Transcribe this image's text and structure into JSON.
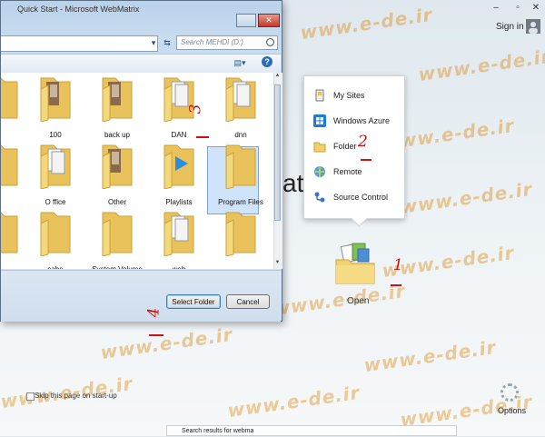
{
  "background_window": {
    "sign_in": "Sign in",
    "sign_in_arrow": "▾",
    "window_controls": {
      "minimize": "–",
      "restore": "▫",
      "close": "✕"
    },
    "title_fragment": "atrix",
    "open_menu": {
      "items": [
        {
          "label": "My Sites",
          "icon": "my-sites-icon"
        },
        {
          "label": "Windows Azure",
          "icon": "windows-azure-icon"
        },
        {
          "label": "Folder",
          "icon": "folder-icon"
        },
        {
          "label": "Remote",
          "icon": "remote-icon"
        },
        {
          "label": "Source Control",
          "icon": "source-control-icon"
        }
      ]
    },
    "open_label": "Open",
    "options_label": "Options",
    "skip_label": "Skip this page on start-up",
    "search_results": "Search results for webma"
  },
  "dialog": {
    "title": "Quick Start - Microsoft WebMatrix",
    "search_placeholder": "Search MEHDI (D:)",
    "folders": [
      {
        "label": ""
      },
      {
        "label": "100"
      },
      {
        "label": "back up"
      },
      {
        "label": "DAN"
      },
      {
        "label": "dnn"
      },
      {
        "label": ""
      },
      {
        "label": "O ffice"
      },
      {
        "label": "Other"
      },
      {
        "label": "Playlists"
      },
      {
        "label": "Program Files"
      },
      {
        "label": ""
      },
      {
        "label": "sabe"
      },
      {
        "label": "System Volume"
      },
      {
        "label": "web"
      },
      {
        "label": ""
      }
    ],
    "select_folder": "Select Folder",
    "cancel": "Cancel"
  },
  "annotations": {
    "n1": "1",
    "n2": "2",
    "n3": "3",
    "n4": "4"
  },
  "watermark_text": "www.e-de.ir",
  "colors": {
    "accent": "#2d6cb5",
    "annotation": "#d01010",
    "watermark": "#e08a12"
  }
}
